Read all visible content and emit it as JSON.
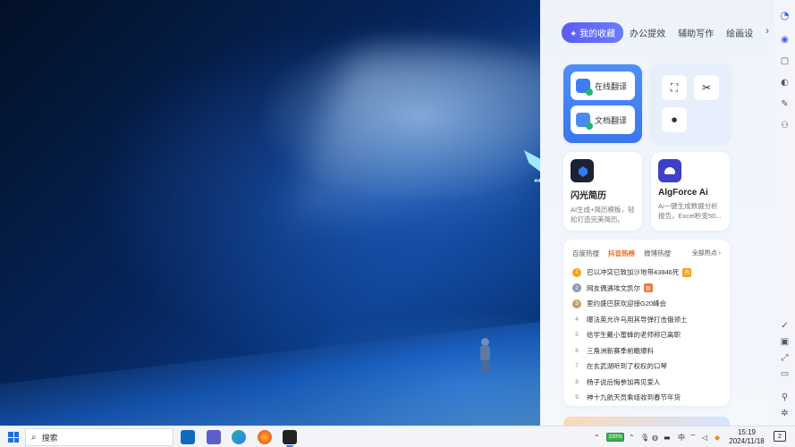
{
  "panel": {
    "tabs": [
      {
        "label": "✦ 我的收藏",
        "active": true
      },
      {
        "label": "办公提效"
      },
      {
        "label": "辅助写作"
      },
      {
        "label": "绘画设"
      }
    ],
    "tab_arrow": "›",
    "translate_card": {
      "online_translate": "在线翻译",
      "doc_translate": "文档翻译"
    },
    "tools": {
      "crop": "⛶",
      "scissors": "✂",
      "record": "⏺"
    },
    "apps": [
      {
        "title": "闪光简历",
        "desc": "AI生成+简历模板，轻松打造完美简历。"
      },
      {
        "title": "AlgForce Ai",
        "desc": "Ai一键生成数据分析报告，Excel秒变50..."
      }
    ],
    "hot": {
      "tabs": [
        {
          "label": "百度热搜"
        },
        {
          "label": "抖音热榜",
          "active": true
        },
        {
          "label": "微博热搜"
        }
      ],
      "all_label": "全部热点 ›",
      "items": [
        {
          "rank": "1",
          "text": "巴以冲突已致加沙地带43846死",
          "tag": "热"
        },
        {
          "rank": "2",
          "text": "网友偶遇埃文凯尔",
          "tag": "新"
        },
        {
          "rank": "3",
          "text": "里约盛巴获欢迎接G20峰会",
          "tag": ""
        },
        {
          "rank": "4",
          "text": "曝法英允许乌用其导弹打击俄领土",
          "tag": ""
        },
        {
          "rank": "5",
          "text": "给学生戴小蜜蜂的老师称已离职",
          "tag": ""
        },
        {
          "rank": "6",
          "text": "三角洲新赛季前瞻爆料",
          "tag": ""
        },
        {
          "rank": "7",
          "text": "在玄武湖听到了权权的口琴",
          "tag": ""
        },
        {
          "rank": "8",
          "text": "杨子说后悔参加再见爱人",
          "tag": ""
        },
        {
          "rank": "9",
          "text": "神十九航天员乘组收到春节年货",
          "tag": ""
        }
      ]
    }
  },
  "rail": {
    "icons": [
      "logo-icon",
      "ai-icon",
      "chat-icon",
      "palette-icon",
      "pen-icon",
      "group-icon",
      "check-circle-icon",
      "screenshot-icon",
      "expand-icon",
      "feedback-icon",
      "pin-icon",
      "settings-icon"
    ]
  },
  "taskbar": {
    "search_placeholder": "搜索",
    "battery": "100%",
    "ime": "中",
    "time": "15:19",
    "date": "2024/11/18",
    "notifications": "2"
  },
  "colors": {
    "accent": "#5b5cf0",
    "translate_card": "#3a76ee",
    "hot_active": "#f06b1f"
  }
}
